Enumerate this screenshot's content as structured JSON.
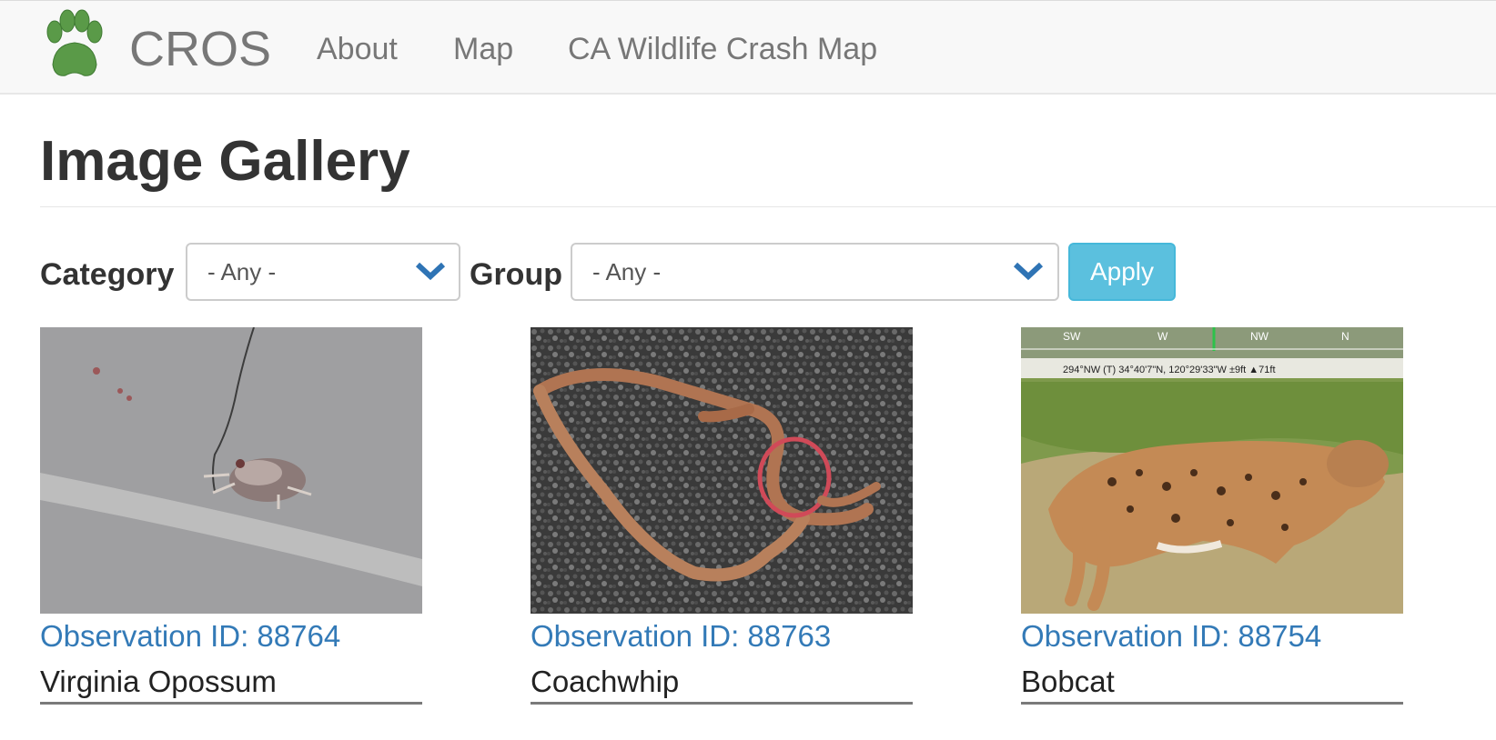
{
  "navbar": {
    "brand": "CROS",
    "links": [
      {
        "label": "About"
      },
      {
        "label": "Map"
      },
      {
        "label": "CA Wildlife Crash Map"
      }
    ],
    "logo_icon": "paw-print-icon",
    "logo_color": "#5a9a48"
  },
  "page": {
    "title": "Image Gallery"
  },
  "filters": {
    "category": {
      "label": "Category",
      "value": "- Any -"
    },
    "group": {
      "label": "Group",
      "value": "- Any -"
    },
    "apply_label": "Apply",
    "dropdown_icon": "chevron-down-icon"
  },
  "gallery": [
    {
      "observation_id": "Observation ID: 88764",
      "species": "Virginia Opossum"
    },
    {
      "observation_id": "Observation ID: 88763",
      "species": "Coachwhip"
    },
    {
      "observation_id": "Observation ID: 88754",
      "species": "Bobcat"
    }
  ],
  "photo_overlay": {
    "compass_headings": [
      "SW",
      "W",
      "NW",
      "N"
    ],
    "gps_readout": "294°NW (T) 34°40'7\"N, 120°29'33\"W ±9ft ▲71ft"
  },
  "colors": {
    "link": "#337ab7",
    "apply_button": "#5bc0de",
    "navbar_bg": "#f8f8f8"
  }
}
